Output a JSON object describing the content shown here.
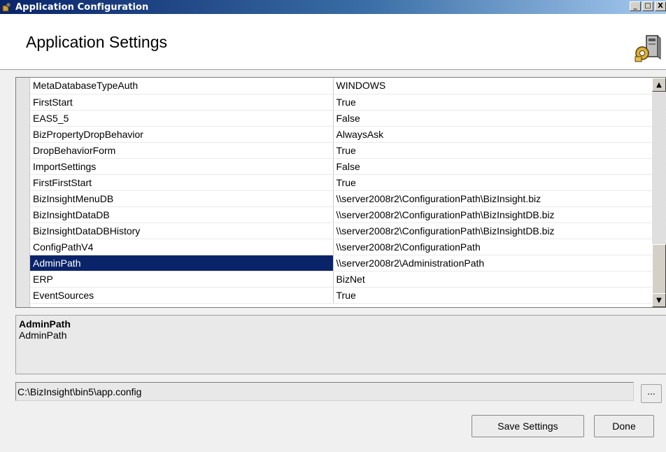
{
  "window": {
    "title": "Application Configuration",
    "controls": {
      "minimize": "_",
      "maximize": "□",
      "close": "X"
    }
  },
  "header": {
    "title": "Application Settings"
  },
  "grid": {
    "rows": [
      {
        "key": "MetaDatabaseTypeAuth",
        "value": "WINDOWS"
      },
      {
        "key": "FirstStart",
        "value": "True"
      },
      {
        "key": "EAS5_5",
        "value": "False"
      },
      {
        "key": "BizPropertyDropBehavior",
        "value": "AlwaysAsk"
      },
      {
        "key": "DropBehaviorForm",
        "value": "True"
      },
      {
        "key": "ImportSettings",
        "value": "False"
      },
      {
        "key": "FirstFirstStart",
        "value": "True"
      },
      {
        "key": "BizInsightMenuDB",
        "value": "\\\\server2008r2\\ConfigurationPath\\BizInsight.biz"
      },
      {
        "key": "BizInsightDataDB",
        "value": "\\\\server2008r2\\ConfigurationPath\\BizInsightDB.biz"
      },
      {
        "key": "BizInsightDataDBHistory",
        "value": "\\\\server2008r2\\ConfigurationPath\\BizInsightDB.biz"
      },
      {
        "key": "ConfigPathV4",
        "value": "\\\\server2008r2\\ConfigurationPath"
      },
      {
        "key": "AdminPath",
        "value": "\\\\server2008r2\\AdministrationPath",
        "selected": true
      },
      {
        "key": "ERP",
        "value": "BizNet"
      },
      {
        "key": "EventSources",
        "value": "True"
      }
    ]
  },
  "description": {
    "title": "AdminPath",
    "text": "AdminPath"
  },
  "config_path": {
    "value": "C:\\BizInsight\\bin5\\app.config",
    "browse_label": "..."
  },
  "buttons": {
    "save": "Save Settings",
    "done": "Done"
  },
  "colors": {
    "selection": "#0a246a",
    "titlebar": "#0a246a"
  }
}
